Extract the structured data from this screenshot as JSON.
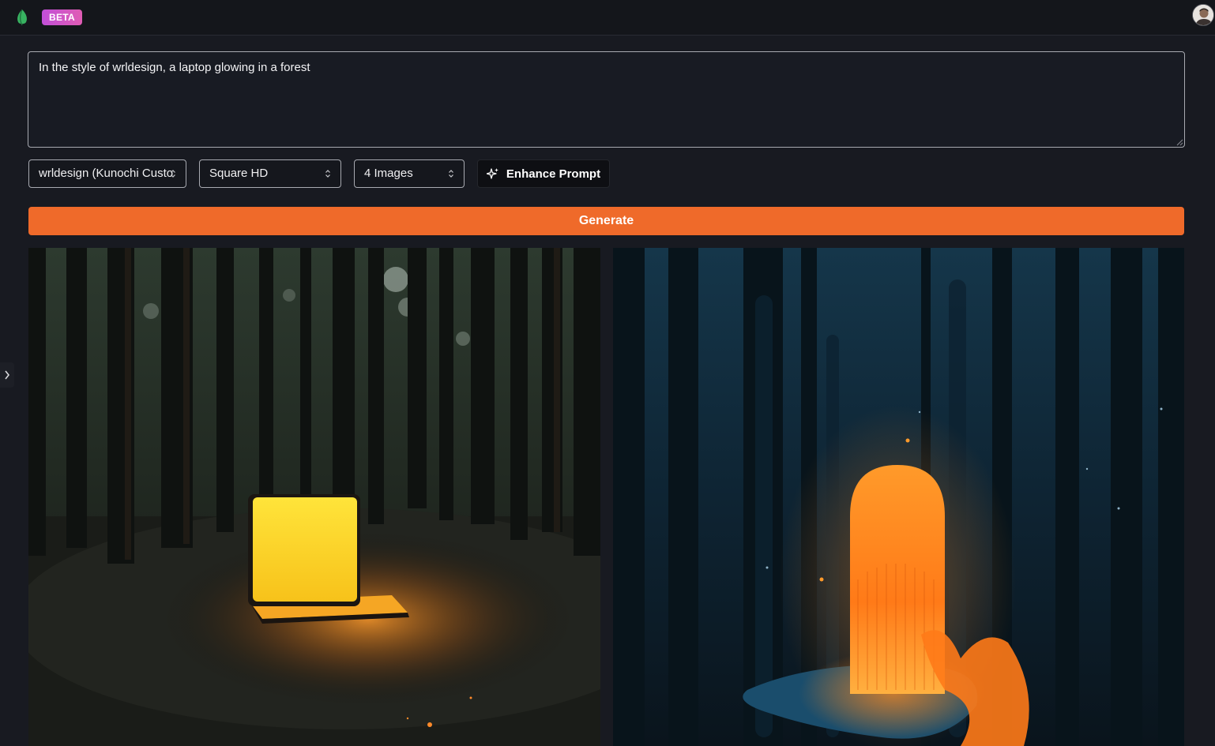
{
  "header": {
    "badge": "BETA",
    "logo_icon": "leaf-logo-icon",
    "avatar_icon": "user-avatar-icon"
  },
  "prompt": {
    "value": "In the style of wrldesign, a laptop glowing in a forest"
  },
  "controls": {
    "style_select": "wrldesign (Kunochi Custo",
    "size_select": "Square HD",
    "count_select": "4 Images",
    "enhance_label": "Enhance Prompt",
    "enhance_icon": "sparkles-icon",
    "generate_label": "Generate"
  },
  "results": {
    "images": [
      {
        "subject": "laptop-forest-image"
      },
      {
        "subject": "glowing-arch-forest-image"
      }
    ]
  },
  "colors": {
    "accent": "#ef6a2a",
    "beta_gradient_start": "#c14fd8",
    "beta_gradient_end": "#e05cb4",
    "background": "#181a21"
  }
}
